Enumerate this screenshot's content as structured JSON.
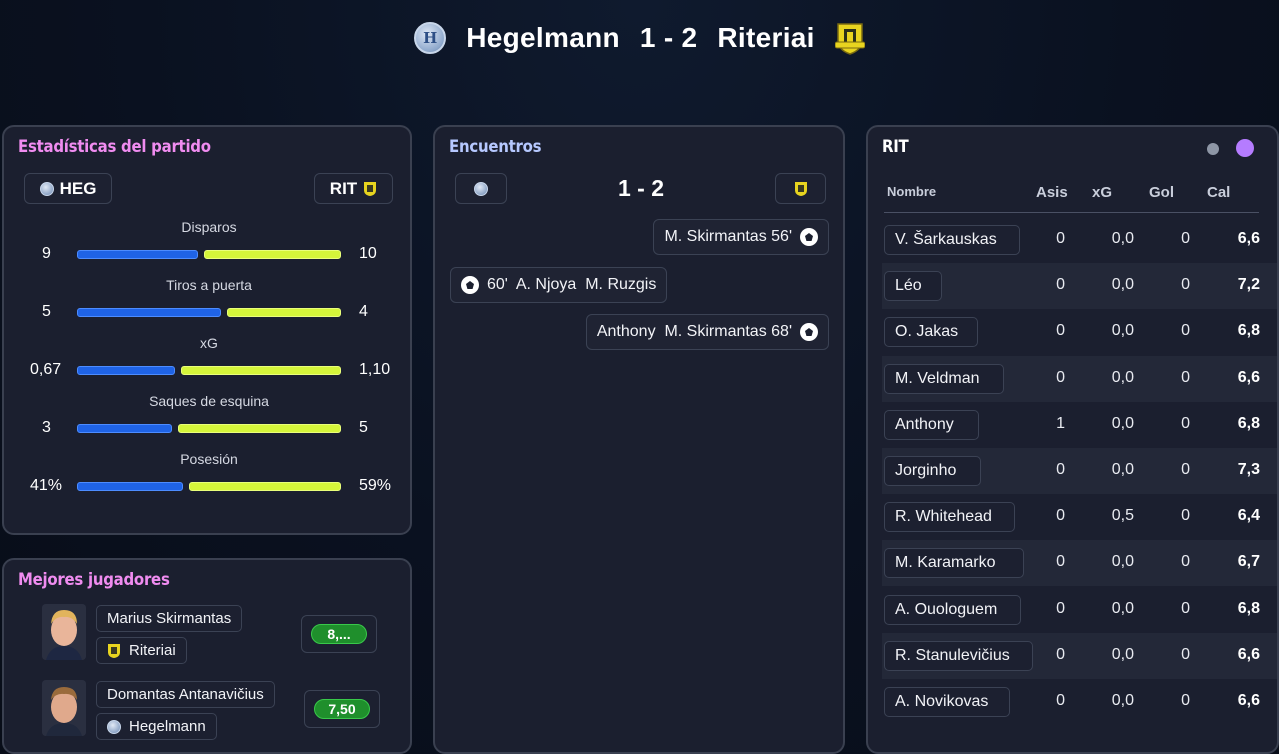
{
  "header": {
    "home_team": "Hegelmann",
    "score": "1 - 2",
    "away_team": "Riteriai"
  },
  "stats_panel": {
    "title": "Estadísticas del partido",
    "home_abbr": "HEG",
    "away_abbr": "RIT",
    "stats": [
      {
        "label": "Disparos",
        "home": "9",
        "away": "10",
        "home_share": 0.47
      },
      {
        "label": "Tiros a puerta",
        "home": "5",
        "away": "4",
        "home_share": 0.56
      },
      {
        "label": "xG",
        "home": "0,67",
        "away": "1,10",
        "home_share": 0.38
      },
      {
        "label": "Saques de esquina",
        "home": "3",
        "away": "5",
        "home_share": 0.37
      },
      {
        "label": "Posesión",
        "home": "41%",
        "away": "59%",
        "home_share": 0.41
      }
    ]
  },
  "best_players": {
    "title": "Mejores jugadores",
    "players": [
      {
        "name": "Marius Skirmantas",
        "team": "Riteriai",
        "rating": "8,..."
      },
      {
        "name": "Domantas Antanavičius",
        "team": "Hegelmann",
        "rating": "7,50"
      }
    ]
  },
  "events_panel": {
    "title": "Encuentros",
    "score": "1 - 2",
    "events": [
      {
        "side": "away",
        "text": "M. Skirmantas 56'"
      },
      {
        "side": "home",
        "text": "60'  A. Njoya  M. Ruzgis"
      },
      {
        "side": "away",
        "text": "Anthony  M. Skirmantas 68'"
      }
    ]
  },
  "lineup_panel": {
    "title": "RIT",
    "columns": [
      "Nombre",
      "Asis",
      "xG",
      "Gol",
      "Cal"
    ],
    "rows": [
      {
        "name": "V. Šarkauskas",
        "asis": "0",
        "xg": "0,0",
        "gol": "0",
        "cal": "6,6"
      },
      {
        "name": "Léo",
        "asis": "0",
        "xg": "0,0",
        "gol": "0",
        "cal": "7,2"
      },
      {
        "name": "O. Jakas",
        "asis": "0",
        "xg": "0,0",
        "gol": "0",
        "cal": "6,8"
      },
      {
        "name": "M. Veldman",
        "asis": "0",
        "xg": "0,0",
        "gol": "0",
        "cal": "6,6"
      },
      {
        "name": "Anthony",
        "asis": "1",
        "xg": "0,0",
        "gol": "0",
        "cal": "6,8"
      },
      {
        "name": "Jorginho",
        "asis": "0",
        "xg": "0,0",
        "gol": "0",
        "cal": "7,3"
      },
      {
        "name": "R. Whitehead",
        "asis": "0",
        "xg": "0,5",
        "gol": "0",
        "cal": "6,4"
      },
      {
        "name": "M. Karamarko",
        "asis": "0",
        "xg": "0,0",
        "gol": "0",
        "cal": "6,7"
      },
      {
        "name": "A. Ouologuem",
        "asis": "0",
        "xg": "0,0",
        "gol": "0",
        "cal": "6,8"
      },
      {
        "name": "R. Stanulevičius",
        "asis": "0",
        "xg": "0,0",
        "gol": "0",
        "cal": "6,6"
      },
      {
        "name": "A. Novikovas",
        "asis": "0",
        "xg": "0,0",
        "gol": "0",
        "cal": "6,6"
      }
    ]
  },
  "colors": {
    "home_bar": "#1f63e6",
    "away_bar": "#d5f53a",
    "title_pink": "#f08cf0",
    "rating_green": "#1f8f2c"
  }
}
